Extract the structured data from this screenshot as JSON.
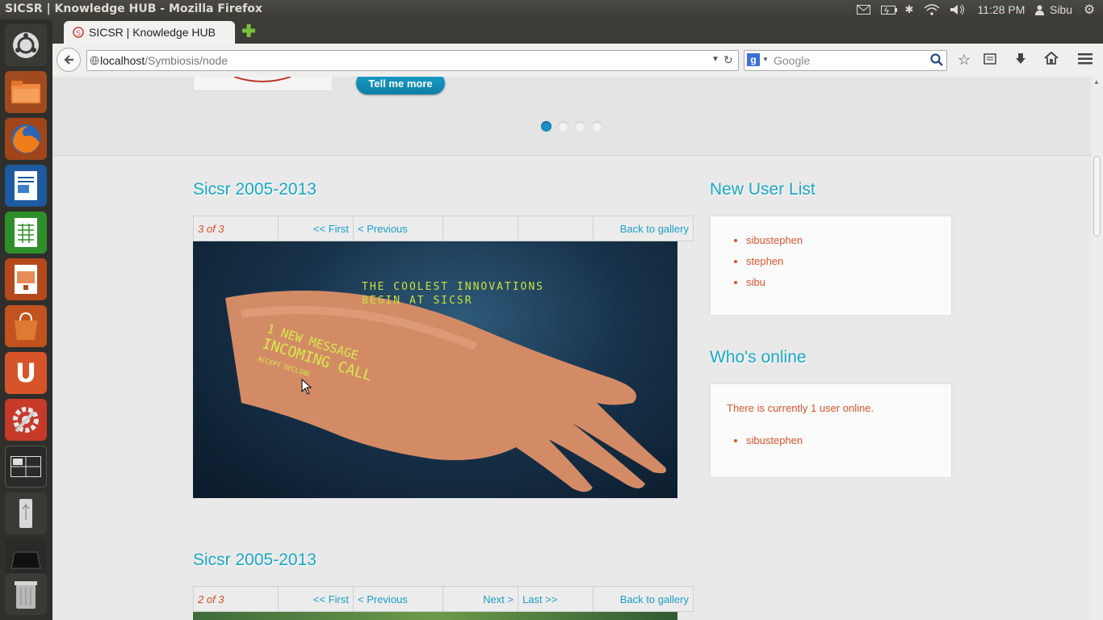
{
  "window": {
    "title": "SICSR | Knowledge HUB - Mozilla Firefox"
  },
  "system": {
    "time": "11:28 PM",
    "user": "Sibu"
  },
  "browser": {
    "tab_title": "SICSR | Knowledge HUB",
    "url_host": "localhost",
    "url_path": "/Symbiosis/node",
    "search_placeholder": "Google"
  },
  "slider": {
    "button_label": "Tell me more",
    "dots": 4,
    "active_dot": 1
  },
  "gallery1": {
    "title": "Sicsr 2005-2013",
    "counter": "3 of 3",
    "first": "<< First",
    "previous": "< Previous",
    "next": "",
    "last": "",
    "back": "Back to gallery",
    "image_caption_line1": "THE COOLEST INNOVATIONS",
    "image_caption_line2": "BEGIN AT SICSR",
    "image_overlay_1": "1 NEW MESSAGE",
    "image_overlay_2": "INCOMING CALL",
    "image_overlay_3": "ACCEPT    DECLINE"
  },
  "gallery2": {
    "title": "Sicsr 2005-2013",
    "counter": "2 of 3",
    "first": "<< First",
    "previous": "< Previous",
    "next": "Next >",
    "last": "Last >>",
    "back": "Back to gallery"
  },
  "new_users": {
    "title": "New User List",
    "users": [
      "sibustephen",
      "stephen",
      "sibu"
    ]
  },
  "whos_online": {
    "title": "Who's online",
    "status": "There is currently 1 user online.",
    "users": [
      "sibustephen"
    ]
  },
  "colors": {
    "accent": "#1aa7c4",
    "link": "#1a9fc9",
    "user_link": "#d9542b"
  }
}
